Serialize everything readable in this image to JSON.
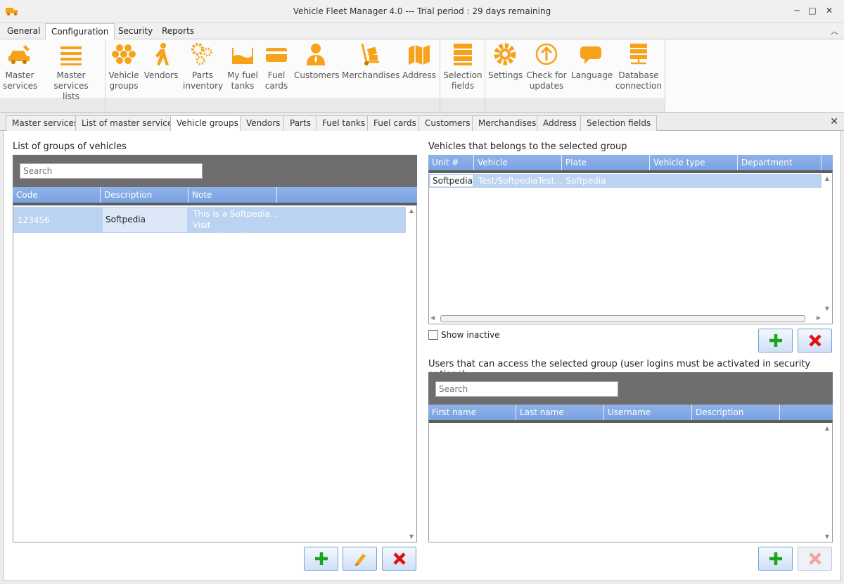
{
  "window": {
    "title": "Vehicle Fleet Manager 4.0 --- Trial period : 29 days remaining",
    "minimize": "−",
    "maximize": "□",
    "close": "✕"
  },
  "menu": {
    "tabs": [
      "General",
      "Configuration",
      "Security",
      "Reports"
    ],
    "active": "Configuration"
  },
  "ribbon": {
    "buttons": [
      {
        "label1": "Master",
        "label2": "services",
        "icon": "car-service-icon"
      },
      {
        "label1": "Master services",
        "label2": "lists",
        "icon": "list-icon"
      },
      {
        "label1": "Vehicle",
        "label2": "groups",
        "icon": "hexagon-group-icon"
      },
      {
        "label1": "Vendors",
        "label2": "",
        "icon": "person-walking-icon"
      },
      {
        "label1": "Parts",
        "label2": "inventory",
        "icon": "gears-icon"
      },
      {
        "label1": "My fuel",
        "label2": "tanks",
        "icon": "fuel-tank-icon"
      },
      {
        "label1": "Fuel",
        "label2": "cards",
        "icon": "card-icon"
      },
      {
        "label1": "Customers",
        "label2": "",
        "icon": "customer-icon"
      },
      {
        "label1": "Merchandises",
        "label2": "",
        "icon": "hand-truck-icon"
      },
      {
        "label1": "Address",
        "label2": "",
        "icon": "map-icon"
      },
      {
        "label1": "Selection",
        "label2": "fields",
        "icon": "selection-fields-icon"
      },
      {
        "label1": "Settings",
        "label2": "",
        "icon": "settings-gear-icon"
      },
      {
        "label1": "Check for",
        "label2": "updates",
        "icon": "update-arrow-icon"
      },
      {
        "label1": "Language",
        "label2": "",
        "icon": "speech-bubble-icon"
      },
      {
        "label1": "Database",
        "label2": "connection",
        "icon": "database-icon"
      }
    ]
  },
  "doc_tabs": {
    "items": [
      "Master services",
      "List of master services",
      "Vehicle groups",
      "Vendors",
      "Parts",
      "Fuel tanks",
      "Fuel cards",
      "Customers",
      "Merchandises",
      "Address",
      "Selection fields"
    ],
    "active": "Vehicle groups"
  },
  "groups_panel": {
    "title": "List of groups of vehicles",
    "search_placeholder": "Search",
    "columns": [
      "Code",
      "Description",
      "Note"
    ],
    "rows": [
      {
        "code": "123456",
        "description": "Softpedia",
        "note_line1": "This is a Softpedia...",
        "note_line2": "Visit win.softpedia.c..."
      }
    ]
  },
  "vehicles_panel": {
    "title": "Vehicles that belongs to the selected group",
    "columns": [
      "Unit #",
      "Vehicle",
      "Plate",
      "Vehicle type",
      "Department"
    ],
    "rows": [
      {
        "unit": "Softpedia",
        "vehicle": "Test/SoftpediaTest...",
        "plate": "Softpedia",
        "vehicle_type": "",
        "department": ""
      }
    ],
    "show_inactive_label": "Show inactive"
  },
  "users_panel": {
    "title": "Users that can access the selected group (user logins must be activated in security options)",
    "search_placeholder": "Search",
    "columns": [
      "First name",
      "Last name",
      "Username",
      "Description"
    ]
  },
  "colors": {
    "accent_orange": "#f7a21b",
    "grid_header_blue": "#7aa3e2",
    "selected_row": "#bcd2f1",
    "add_green": "#1aa51a",
    "delete_red": "#e01010"
  }
}
